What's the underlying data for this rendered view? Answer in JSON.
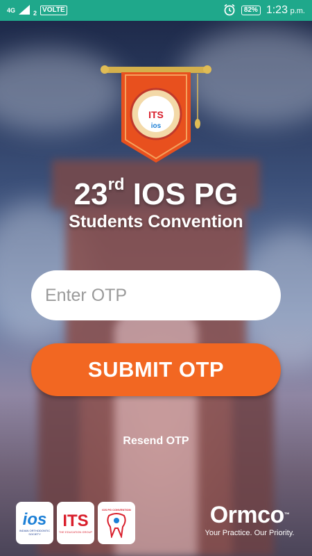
{
  "status_bar": {
    "network": "4G",
    "sim": "2",
    "volte": "VOLTE",
    "battery": "82%",
    "time": "1:23",
    "ampm": "p.m."
  },
  "event": {
    "title_number": "23",
    "title_suffix": "rd",
    "title_rest": " IOS PG",
    "subtitle": "Students Convention"
  },
  "form": {
    "otp_placeholder": "Enter OTP",
    "otp_value": "",
    "submit_label": "SUBMIT OTP",
    "resend_label": "Resend OTP"
  },
  "footer": {
    "ios_logo_text": "ios",
    "ios_caption": "INDIAN ORTHODONTIC SOCIETY",
    "its_logo_text": "ITS",
    "its_caption": "THE EDUCATION GROUP",
    "convention_logo_text": "IOS PG CONVENTION",
    "sponsor_name": "Ormco",
    "sponsor_tagline": "Your Practice. Our Priority."
  },
  "colors": {
    "status_bar": "#1fa88b",
    "accent": "#f26722",
    "input_bg": "#ffffff",
    "text": "#ffffff"
  },
  "icons": [
    "signal-icon",
    "alarm-icon",
    "battery-icon",
    "banner-logo-icon"
  ]
}
